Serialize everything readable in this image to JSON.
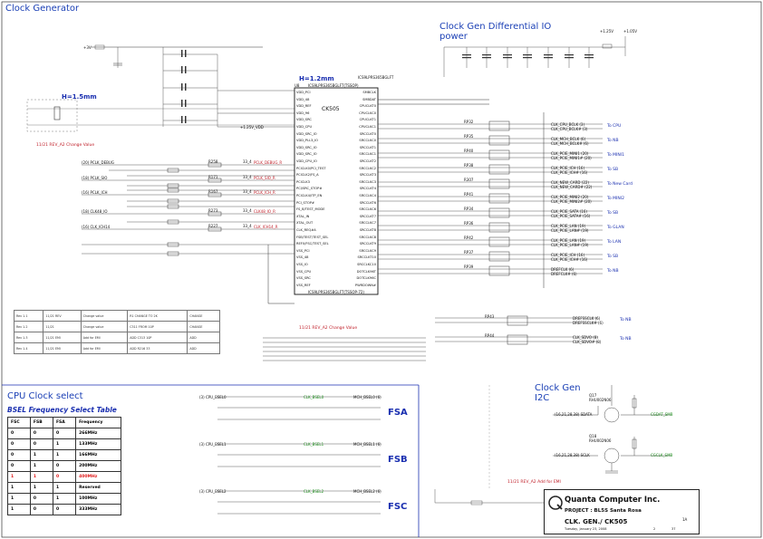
{
  "titles": {
    "clock_generator": "Clock Generator",
    "diff_io_power": "Clock Gen Differential IO\npower",
    "cpu_clock_select": "CPU Clock select",
    "bsel_table_title": "BSEL Frequency Select Table",
    "clock_gen_i2c": "Clock Gen\nI2C"
  },
  "notes": {
    "h_1_2mm": "H=1.2mm",
    "h_1_5mm": "H=1.5mm",
    "change_value_1": "11/21 REV_A2 Change Value",
    "change_value_2": "11/21 REV_A2 Change Value",
    "add_for_emi": "11/21 REV_A2 Add for EMI"
  },
  "chip": {
    "ref": "U8",
    "part": "ICS9LPRS365BGLFT",
    "package": "ICS9LPRS365BGLFT(TSSOP)",
    "name": "CK505",
    "footer": "ICS9LPRS365BGLFT(TSSOP-72)",
    "left_pins": [
      "VDD_PCI",
      "VDD_48",
      "VDD_REF",
      "VDD_96",
      "VDD_SRC",
      "VDD_CPU",
      "VDD_SRC_IO",
      "VDD_PLL3_IO",
      "VDD_SRC_IO",
      "VDD_SRC_IO",
      "VDD_CPU_IO",
      "PCICLK0/PCI_TEST",
      "PCICLK2/FS_A",
      "PCICLK3",
      "PCI/SRC_STOP#",
      "PCICLK4/ITP_EN",
      "PCI_STOP#",
      "FS_B/TEST_MODE",
      "XTAL_IN",
      "XTAL_OUT",
      "CLK_REQ#A",
      "FSB/TEST/TEST_SEL",
      "REF0/FSC/TEST_SEL",
      "VSS_PCI",
      "VSS_48",
      "VSS_IO",
      "VSS_CPU",
      "VSS_SRC",
      "VSS_REF"
    ],
    "right_pins": [
      "SMBCLK",
      "SMBDAT",
      "CPUCLKT0",
      "CPUCLKC0",
      "CPUCLKT1",
      "CPUCLKC1",
      "SRCCLKT0",
      "SRCCLKC0",
      "SRCCLKT1",
      "SRCCLKC1",
      "SRCCLKT2",
      "SRCCLKC2",
      "SRCCLKT3",
      "SRCCLKC3",
      "SRCCLKT4",
      "SRCCLKC4",
      "SRCCLKT6",
      "SRCCLKC6",
      "SRCCLKT7",
      "SRCCLKC7",
      "SRCCLKT8",
      "SRCCLKC8",
      "SRCCLKT9",
      "SRCCLKC9",
      "SRCCLKT10",
      "SRCCLKC10",
      "DOTCLK96T",
      "DOTCLK96C",
      "PWRDOWN#"
    ]
  },
  "power_nets": {
    "p3v": "+3V",
    "p1_25v": "+1.25V",
    "p1_05v": "+1.05V",
    "vdd_l": "+1.25V_VDD"
  },
  "left_signals": [
    {
      "label": "(20) PCLK_DEBUG",
      "res": "R258",
      "val": "33_4",
      "net": "PCLK_DEBUG_R"
    },
    {
      "label": "(18) PCLK_SIO",
      "res": "R171",
      "val": "33_4",
      "net": "PCLK_SIO_R"
    },
    {
      "label": "(16) PCLK_ICH",
      "res": "R167",
      "val": "33_4",
      "net": "PCLK_ICH_R"
    },
    {
      "label": "(18) CLK48_IO",
      "res": "R273",
      "val": "33_4",
      "net": "CLK48_IO_R"
    },
    {
      "label": "(16) CLK_ICH14",
      "res": "R227",
      "val": "33_4",
      "net": "CLK_ICH14_R"
    }
  ],
  "right_signals": [
    {
      "group": "CPU",
      "res": "RP32",
      "nets": [
        "CLK_CPU_BCLK (3)",
        "CLK_CPU_BCLK# (3)"
      ],
      "dest": "To CPU"
    },
    {
      "group": "MCH",
      "res": "RP35",
      "nets": [
        "CLK_MCH_BCLK (6)",
        "CLK_MCH_BCLK# (6)"
      ],
      "dest": "To NB"
    },
    {
      "group": "PCIE",
      "res": "RP40",
      "nets": [
        "CLK_PCIE_MINI1 (20)",
        "CLK_PCIE_MINI1# (20)"
      ],
      "dest": "To MINI1"
    },
    {
      "group": "ICH",
      "res": "RP38",
      "nets": [
        "CLK_PCIE_ICH (16)",
        "CLK_PCIE_ICH# (16)"
      ],
      "dest": "To SB"
    },
    {
      "group": "NEW",
      "res": "R307",
      "nets": [
        "CLK_NEW_CARD (22)",
        "CLK_NEW_CARD# (22)"
      ],
      "dest": "To New Card"
    },
    {
      "group": "MINI2",
      "res": "RP41",
      "nets": [
        "CLK_PCIE_MINI2 (20)",
        "CLK_PCIE_MINI2# (20)"
      ],
      "dest": "To MINI2"
    },
    {
      "group": "SATA",
      "res": "RP34",
      "nets": [
        "CLK_PCIE_SATA (16)",
        "CLK_PCIE_SATA# (16)"
      ],
      "dest": "To SB"
    },
    {
      "group": "GLAN",
      "res": "RP36",
      "nets": [
        "CLK_PCIE_LAN (19)",
        "CLK_PCIE_LAN# (19)"
      ],
      "dest": "To GLAN"
    },
    {
      "group": "LAN",
      "res": "RP42",
      "nets": [
        "CLK_PCIE_LAN (19)",
        "CLK_PCIE_LAN# (19)"
      ],
      "dest": "To LAN"
    },
    {
      "group": "SB",
      "res": "RP37",
      "nets": [
        "CLK_PCIE_ICH (16)",
        "CLK_PCIE_ICH# (16)"
      ],
      "dest": "To SB"
    },
    {
      "group": "NB",
      "res": "RP39",
      "nets": [
        "DREFCLK (6)",
        "DREFCLK# (6)"
      ],
      "dest": "To NB"
    }
  ],
  "dref_signals": [
    {
      "res": "RP43",
      "nets": [
        "DREFSSCLK (6)",
        "DREFSSCLK# (6)"
      ],
      "dest": "To NB"
    },
    {
      "res": "RP44",
      "nets": [
        "CLK_SDVO (8)",
        "CLK_SDVO# (8)"
      ],
      "dest": "To NB"
    }
  ],
  "bsel_table": {
    "headers": [
      "FSC",
      "FSB",
      "FSA",
      "Frequency"
    ],
    "rows": [
      [
        "0",
        "0",
        "0",
        "266MHz"
      ],
      [
        "0",
        "0",
        "1",
        "133MHz"
      ],
      [
        "0",
        "1",
        "1",
        "166MHz"
      ],
      [
        "0",
        "1",
        "0",
        "200MHz"
      ],
      [
        "1",
        "1",
        "0",
        "400MHz"
      ],
      [
        "1",
        "1",
        "1",
        "Reserved"
      ],
      [
        "1",
        "0",
        "1",
        "100MHz"
      ],
      [
        "1",
        "0",
        "0",
        "333MHz"
      ]
    ],
    "highlight_row": 4
  },
  "fs_blocks": [
    {
      "name": "FSA",
      "cpu_net": "(3) CPU_BSEL0",
      "mch_net": "MCH_BSEL0 (6)",
      "clk_net": "CLK_BSEL0"
    },
    {
      "name": "FSB",
      "cpu_net": "(3) CPU_BSEL1",
      "mch_net": "MCH_BSEL1 (6)",
      "clk_net": "CLK_BSEL1"
    },
    {
      "name": "FSC",
      "cpu_net": "(3) CPU_BSEL2",
      "mch_net": "MCH_BSEL2 (6)",
      "clk_net": "CLK_BSEL2"
    }
  ],
  "i2c": {
    "q1": "Q17",
    "q1_part": "RHU002N06",
    "q2": "Q18",
    "q2_part": "RHU002N06",
    "sda_in": "(16,21,28,38) SDATA",
    "scl_in": "(16,21,28,38) SCLK",
    "sda_out": "CGDAT_SMB",
    "scl_out": "CGCLK_SMB"
  },
  "revision_table": {
    "rows": [
      [
        "Rev 1.1",
        "11/21 REV",
        "Change value",
        "R1 CHANGE TO 2K",
        "CHANGE"
      ],
      [
        "Rev 1.2",
        "11/21",
        "Change value",
        "C311 FROM 10P",
        "CHANGE"
      ],
      [
        "Rev 1.3",
        "11/21 EMI",
        "Add for EMI",
        "ADD C313 10P",
        "ADD"
      ],
      [
        "Rev 1.4",
        "11/21 EMI",
        "Add for EMI",
        "ADD R216 33",
        "ADD"
      ]
    ]
  },
  "title_block": {
    "company": "Quanta Computer Inc.",
    "project": "PROJECT : BL5S Santa Rosa",
    "doc": "CLK. GEN./ CK505",
    "rev": "1A",
    "date": "Tuesday, January 23, 2008",
    "sheet": "2",
    "of": "37"
  }
}
